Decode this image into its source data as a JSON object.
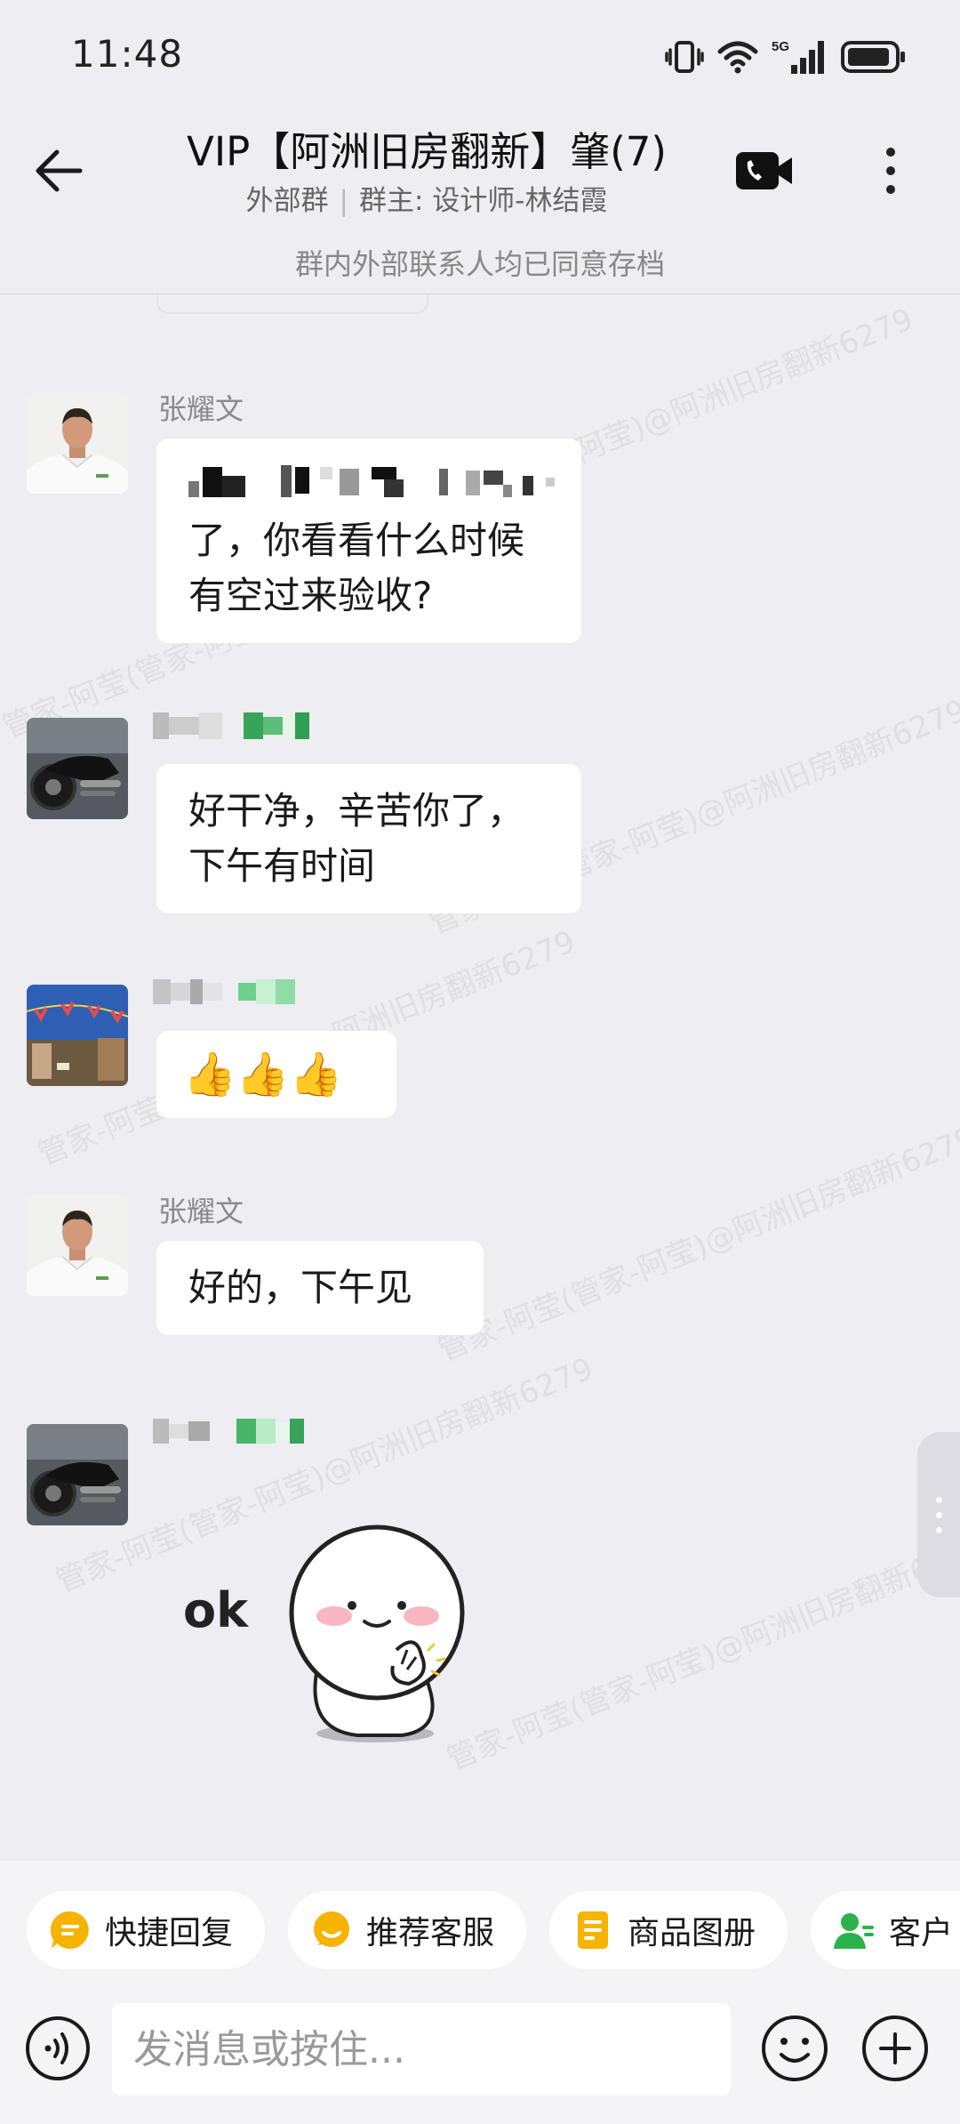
{
  "status_bar": {
    "time": "11:48",
    "icons": [
      "vibrate-icon",
      "wifi-icon",
      "5g-signal-icon",
      "battery-icon"
    ],
    "network": "5G"
  },
  "header": {
    "title": "VIP【阿洲旧房翻新】肇(7)",
    "sub_type": "外部群",
    "sub_owner": "群主: 设计师-林结霞",
    "archive_notice": "群内外部联系人均已同意存档"
  },
  "watermark": {
    "text": "管家-阿莹(管家-阿莹)@阿洲旧房翻新6279"
  },
  "messages": [
    {
      "sender": "张耀文",
      "avatar": "photo-man-white-shirt",
      "text_redacted": true,
      "text": "了，你看看什么时候有空过来验收?"
    },
    {
      "sender": "",
      "sender_redacted": true,
      "avatar": "photo-motorcycle",
      "text": "好干净，辛苦你了，下午有时间"
    },
    {
      "sender": "",
      "sender_redacted": true,
      "avatar": "photo-street-flags",
      "emoji": "👍👍👍"
    },
    {
      "sender": "张耀文",
      "avatar": "photo-man-white-shirt",
      "text": "好的，下午见"
    },
    {
      "sender": "",
      "sender_redacted": true,
      "avatar": "photo-motorcycle",
      "sticker": "ok-dumpling-sticker",
      "sticker_text": "ok"
    }
  ],
  "quick_actions": [
    {
      "label": "快捷回复",
      "icon": "quick-reply-icon",
      "color": "#f5b400"
    },
    {
      "label": "推荐客服",
      "icon": "recommend-service-icon",
      "color": "#f5b400"
    },
    {
      "label": "商品图册",
      "icon": "catalog-icon",
      "color": "#f5b400"
    },
    {
      "label": "客户",
      "icon": "customer-icon",
      "color": "#2bb24c"
    }
  ],
  "input": {
    "placeholder": "发消息或按住..."
  },
  "colors": {
    "background": "#ededf2",
    "bubble": "#ffffff",
    "accent_yellow": "#f5b400",
    "accent_green": "#2bb24c"
  }
}
